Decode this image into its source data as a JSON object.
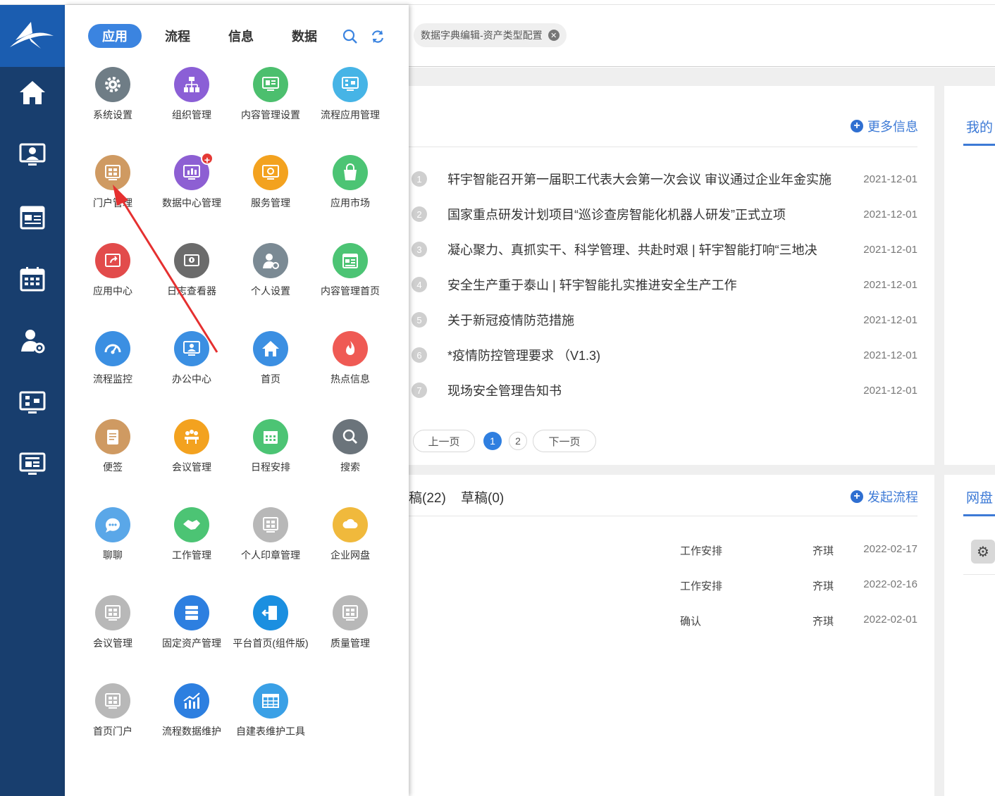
{
  "drawer": {
    "tabs": [
      "应用",
      "流程",
      "信息",
      "数据"
    ],
    "apps": [
      {
        "label": "系统设置",
        "color": "#6f7d86",
        "icon": "gear-icon"
      },
      {
        "label": "组织管理",
        "color": "#8b5fd6",
        "icon": "org-chart-icon"
      },
      {
        "label": "内容管理设置",
        "color": "#4cbf6e",
        "icon": "monitor-icon"
      },
      {
        "label": "流程应用管理",
        "color": "#46b4e6",
        "icon": "flow-monitor-icon"
      },
      {
        "label": "门户管理",
        "color": "#cf9a62",
        "icon": "window-grid-icon"
      },
      {
        "label": "数据中心管理",
        "color": "#8d5fd3",
        "icon": "bar-chart-monitor-icon",
        "badge": "+"
      },
      {
        "label": "服务管理",
        "color": "#f3a21f",
        "icon": "service-monitor-icon"
      },
      {
        "label": "应用市场",
        "color": "#4cc474",
        "icon": "shopping-bag-icon"
      },
      {
        "label": "应用中心",
        "color": "#e24b4b",
        "icon": "share-window-icon"
      },
      {
        "label": "日志查看器",
        "color": "#6b6b6b",
        "icon": "log-icon"
      },
      {
        "label": "个人设置",
        "color": "#7b8a94",
        "icon": "user-gear-icon"
      },
      {
        "label": "内容管理首页",
        "color": "#4cc474",
        "icon": "calendar-doc-icon"
      },
      {
        "label": "流程监控",
        "color": "#3b8fe2",
        "icon": "gauge-icon"
      },
      {
        "label": "办公中心",
        "color": "#3b8fe2",
        "icon": "user-monitor-icon"
      },
      {
        "label": "首页",
        "color": "#3b8fe2",
        "icon": "home-icon"
      },
      {
        "label": "热点信息",
        "color": "#ef5a54",
        "icon": "flame-icon"
      },
      {
        "label": "便签",
        "color": "#cf9a62",
        "icon": "note-icon"
      },
      {
        "label": "会议管理",
        "color": "#f3a21f",
        "icon": "meeting-icon"
      },
      {
        "label": "日程安排",
        "color": "#4cc474",
        "icon": "calendar-icon"
      },
      {
        "label": "搜索",
        "color": "#6b747b",
        "icon": "search-icon"
      },
      {
        "label": "聊聊",
        "color": "#5aa7e8",
        "icon": "chat-bubble-icon"
      },
      {
        "label": "工作管理",
        "color": "#4cc474",
        "icon": "handshake-icon"
      },
      {
        "label": "个人印章管理",
        "color": "#b8b8b8",
        "icon": "window-grid-icon"
      },
      {
        "label": "企业网盘",
        "color": "#f0b93c",
        "icon": "cloud-folder-icon"
      },
      {
        "label": "会议管理",
        "color": "#b8b8b8",
        "icon": "window-grid-icon"
      },
      {
        "label": "固定资产管理",
        "color": "#2d7fe0",
        "icon": "server-saas-icon"
      },
      {
        "label": "平台首页(组件版)",
        "color": "#1b8fe0",
        "icon": "exit-door-icon"
      },
      {
        "label": "质量管理",
        "color": "#b8b8b8",
        "icon": "window-grid-icon"
      },
      {
        "label": "首页门户",
        "color": "#b8b8b8",
        "icon": "window-grid-icon"
      },
      {
        "label": "流程数据维护",
        "color": "#2d7fe0",
        "icon": "growth-chart-icon"
      },
      {
        "label": "自建表维护工具",
        "color": "#3aa0e6",
        "icon": "table-icon"
      }
    ]
  },
  "tabbar": {
    "active_tab": "数据字典编辑-资产类型配置"
  },
  "news": {
    "more_label": "更多信息",
    "items": [
      {
        "n": "1",
        "title": "轩宇智能召开第一届职工代表大会第一次会议 审议通过企业年金实施",
        "date": "2021-12-01"
      },
      {
        "n": "2",
        "title": "国家重点研发计划项目“巡诊查房智能化机器人研发”正式立项",
        "date": "2021-12-01"
      },
      {
        "n": "3",
        "title": "凝心聚力、真抓实干、科学管理、共赴时艰 | 轩宇智能打响“三地决",
        "date": "2021-12-01"
      },
      {
        "n": "4",
        "title": "安全生产重于泰山 | 轩宇智能扎实推进安全生产工作",
        "date": "2021-12-01"
      },
      {
        "n": "5",
        "title": "关于新冠疫情防范措施",
        "date": "2021-12-01"
      },
      {
        "n": "6",
        "title": "*疫情防控管理要求 （V1.3)",
        "date": "2021-12-01"
      },
      {
        "n": "7",
        "title": "现场安全管理告知书",
        "date": "2021-12-01"
      }
    ],
    "pager": {
      "prev": "上一页",
      "pages": [
        "1",
        "2"
      ],
      "next": "下一页"
    }
  },
  "side_top": {
    "label": "我的"
  },
  "side_bottom": {
    "label": "网盘"
  },
  "flow": {
    "tab_partial": "稿(22)",
    "tab_draft": "草稿(0)",
    "start_label": "发起流程",
    "rows": [
      {
        "type": "工作安排",
        "user": "齐琪",
        "date": "2022-02-17"
      },
      {
        "type": "工作安排",
        "user": "齐琪",
        "date": "2022-02-16"
      },
      {
        "type": "确认",
        "user": "齐琪",
        "date": "2022-02-01"
      }
    ]
  },
  "colors": {
    "rail": "#183e6e",
    "logo_bg": "#1b5db0",
    "accent": "#3b84e0",
    "arrow": "#e53030"
  }
}
